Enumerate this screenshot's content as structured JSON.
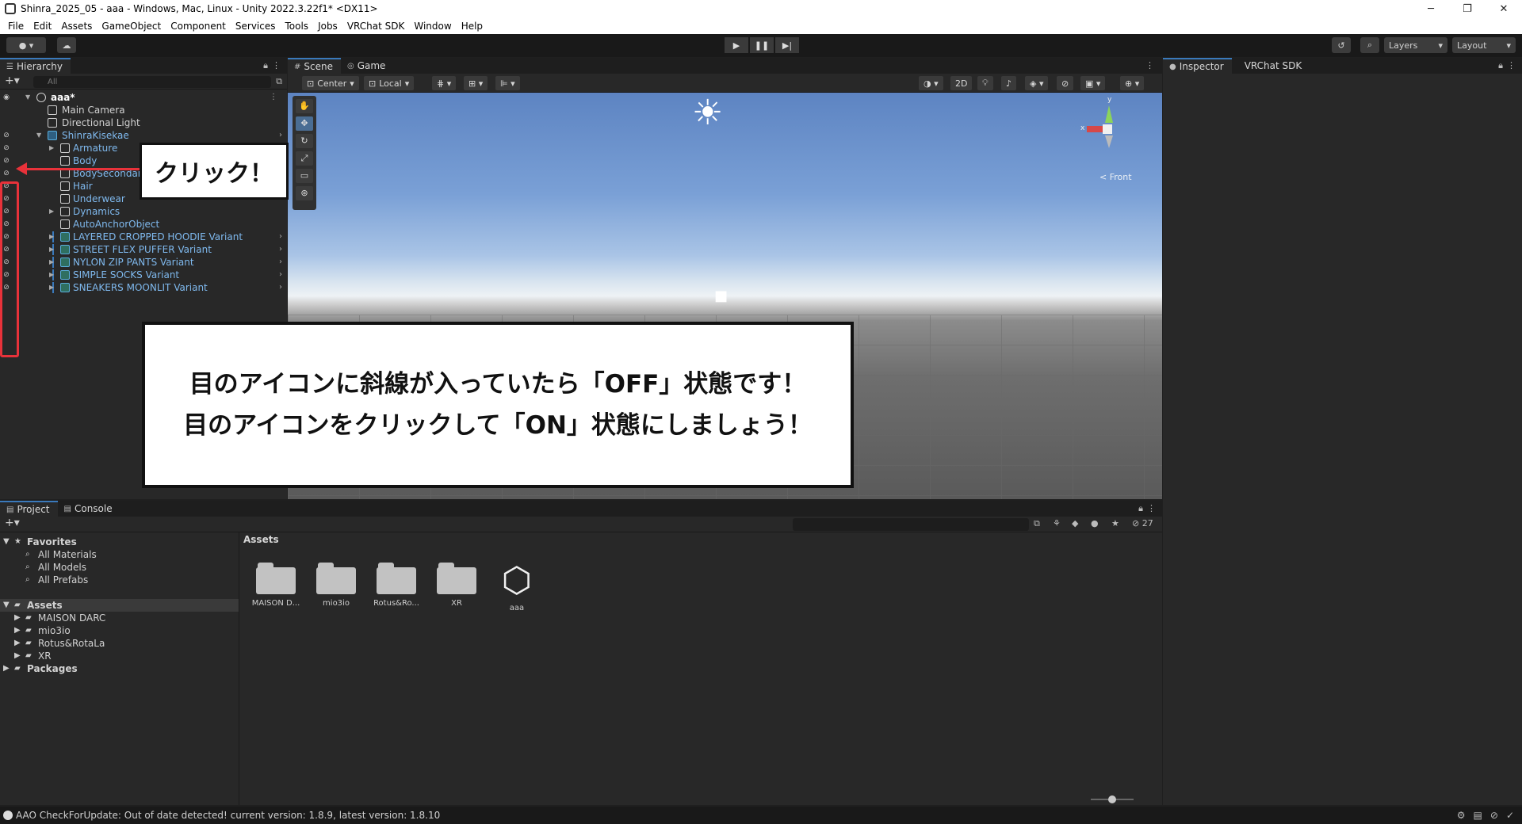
{
  "window": {
    "title": "Shinra_2025_05 - aaa - Windows, Mac, Linux - Unity 2022.3.22f1* <DX11>"
  },
  "menu": [
    "File",
    "Edit",
    "Assets",
    "GameObject",
    "Component",
    "Services",
    "Tools",
    "Jobs",
    "VRChat SDK",
    "Window",
    "Help"
  ],
  "toolbar": {
    "layers_label": "Layers",
    "layout_label": "Layout"
  },
  "hierarchy": {
    "tab_label": "Hierarchy",
    "search_placeholder": "All",
    "root": "aaa*",
    "items": [
      {
        "label": "Main Camera"
      },
      {
        "label": "Directional Light"
      },
      {
        "label": "ShinraKisekae"
      },
      {
        "label": "Armature"
      },
      {
        "label": "Body"
      },
      {
        "label": "BodySecondary"
      },
      {
        "label": "Hair"
      },
      {
        "label": "Underwear"
      },
      {
        "label": "Dynamics"
      },
      {
        "label": "AutoAnchorObject"
      },
      {
        "label": "LAYERED CROPPED HOODIE Variant"
      },
      {
        "label": "STREET FLEX PUFFER Variant"
      },
      {
        "label": "NYLON ZIP PANTS Variant"
      },
      {
        "label": "SIMPLE SOCKS Variant"
      },
      {
        "label": "SNEAKERS MOONLIT Variant"
      }
    ]
  },
  "annotations": {
    "click_label": "クリック！",
    "instruction_line1": "目のアイコンに斜線が入っていたら「OFF」状態です！",
    "instruction_line2": "目のアイコンをクリックして「ON」状態にしましょう！"
  },
  "scene": {
    "tab_scene": "Scene",
    "tab_game": "Game",
    "pivot_label": "Center",
    "space_label": "Local",
    "mode_2d": "2D",
    "front_label": "< Front",
    "gizmo_y": "y",
    "gizmo_x": "x"
  },
  "inspector": {
    "tab_inspector": "Inspector",
    "tab_vrchat": "VRChat SDK"
  },
  "project": {
    "tab_project": "Project",
    "tab_console": "Console",
    "hidden_count": "27",
    "favorites_label": "Favorites",
    "favorites": [
      "All Materials",
      "All Models",
      "All Prefabs"
    ],
    "assets_label": "Assets",
    "asset_folders": [
      "MAISON DARC",
      "mio3io",
      "Rotus&RotaLa",
      "XR"
    ],
    "packages_label": "Packages",
    "assets_path": "Assets",
    "tiles": [
      {
        "name": "MAISON D..."
      },
      {
        "name": "mio3io"
      },
      {
        "name": "Rotus&Ro..."
      },
      {
        "name": "XR"
      },
      {
        "name": "aaa"
      }
    ]
  },
  "status": {
    "message": "AAO CheckForUpdate: Out of date detected! current version: 1.8.9, latest version: 1.8.10"
  }
}
